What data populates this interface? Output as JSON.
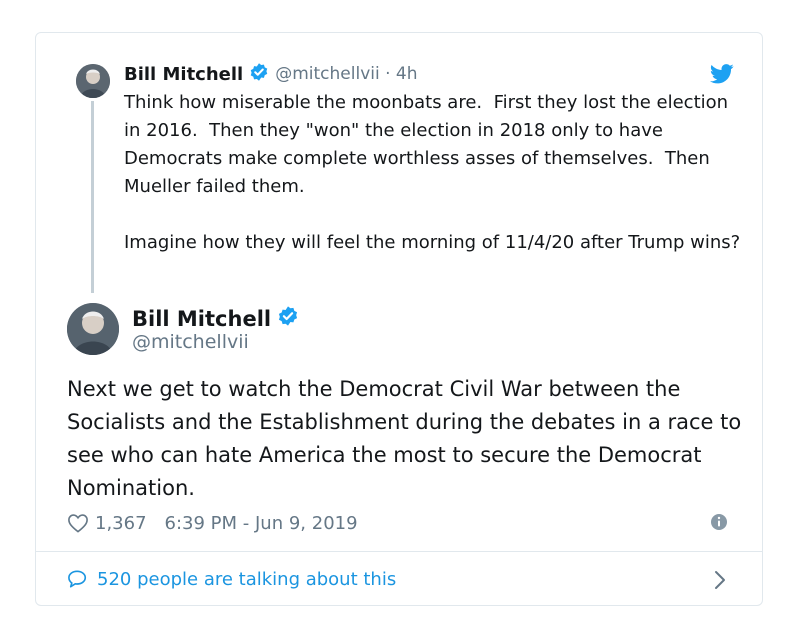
{
  "quoted_tweet": {
    "author_name": "Bill Mitchell",
    "handle_time": "@mitchellvii · 4h",
    "text": "Think how miserable the moonbats are.  First they lost the election in 2016.  Then they \"won\" the election in 2018 only to have Democrats make complete worthless asses of themselves.  Then Mueller failed them.\n\nImagine how they will feel the morning of 11/4/20 after Trump wins?"
  },
  "main_tweet": {
    "author_name": "Bill Mitchell",
    "handle": "@mitchellvii",
    "text": "Next we get to watch the Democrat Civil War between the Socialists and the Establishment during the debates in a race to see who can hate America the most to secure the Democrat Nomination.",
    "like_count": "1,367",
    "timestamp": "6:39 PM - Jun 9, 2019"
  },
  "footer": {
    "talking_label": "520 people are talking about this"
  },
  "colors": {
    "accent": "#1da1f2",
    "link": "#1b95e0",
    "secondary_text": "#657786",
    "border": "#e1e8ed"
  },
  "icons": [
    "verified-icon",
    "twitter-bird-icon",
    "heart-icon",
    "info-icon",
    "speech-bubble-icon",
    "chevron-right-icon"
  ]
}
